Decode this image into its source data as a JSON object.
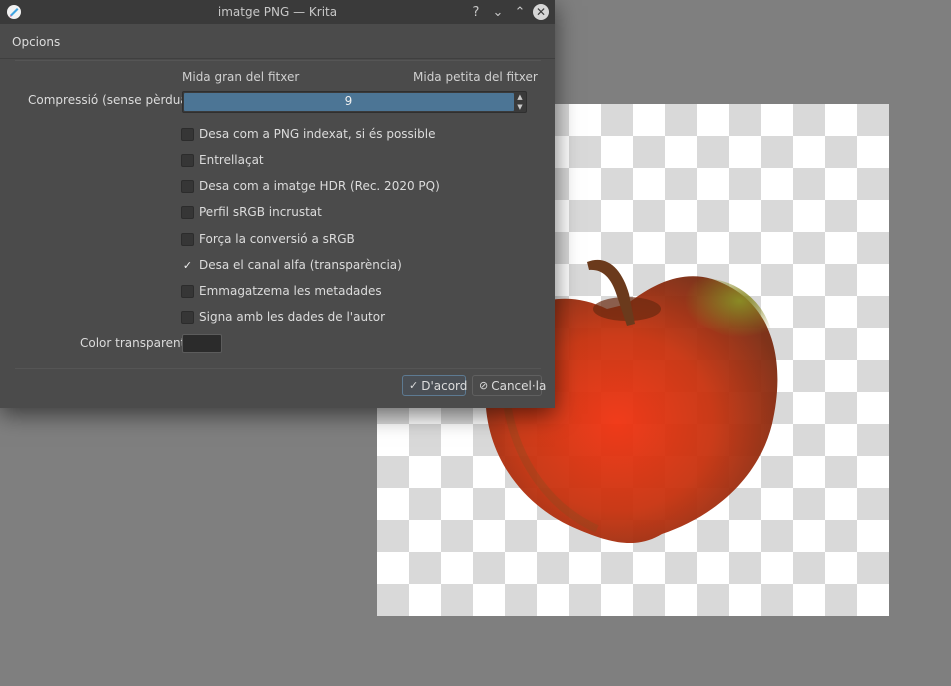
{
  "window": {
    "title": "imatge PNG — Krita"
  },
  "titlebar_controls": {
    "help": "?",
    "minimize": "⌄",
    "maximize": "⌃",
    "close": "✕"
  },
  "tab": {
    "label": "Opcions"
  },
  "compression": {
    "label": "Compressió (sense pèrdua):",
    "size_large": "Mida gran del fitxer",
    "size_small": "Mida petita del fitxer",
    "value": "9"
  },
  "options": [
    {
      "label": "Desa com a PNG indexat, si és possible",
      "checked": false
    },
    {
      "label": "Entrellaçat",
      "checked": false
    },
    {
      "label": "Desa com a imatge HDR (Rec. 2020 PQ)",
      "checked": false
    },
    {
      "label": "Perfil sRGB incrustat",
      "checked": false
    },
    {
      "label": "Força la conversió a sRGB",
      "checked": false
    },
    {
      "label": "Desa el canal alfa (transparència)",
      "checked": true
    },
    {
      "label": "Emmagatzema les metadades",
      "checked": false
    },
    {
      "label": "Signa amb les dades de l'autor",
      "checked": false
    }
  ],
  "transparent_color": {
    "label": "Color transparent:",
    "value": "#2b2b2b"
  },
  "buttons": {
    "ok": "D'acord",
    "cancel": "Cancel·la"
  },
  "colors": {
    "dialog_bg": "#4b4b4b",
    "accent": "#4c7595",
    "workspace_bg": "#7f7f7f"
  }
}
